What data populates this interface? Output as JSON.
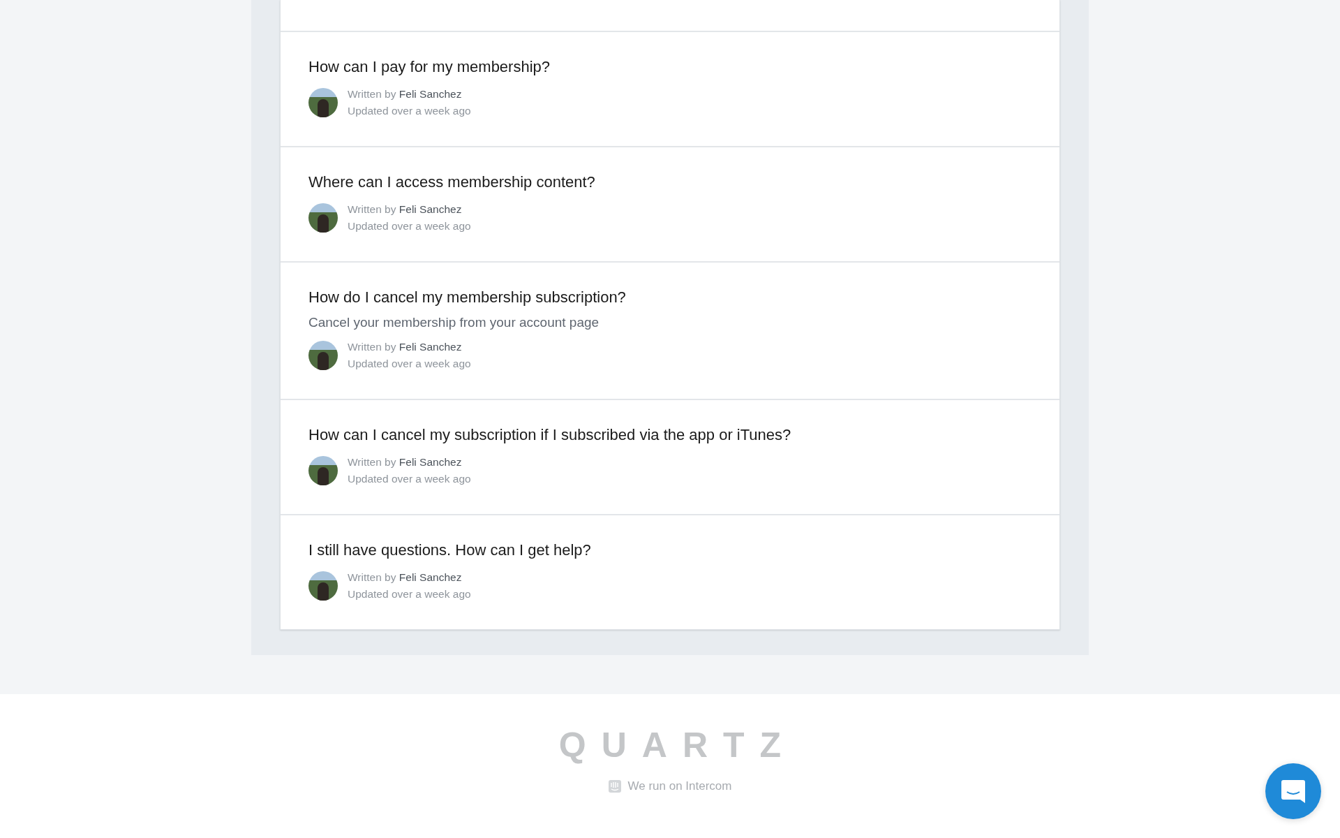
{
  "articles": [
    {
      "title": "How can I pay for my membership?",
      "written_by": "Written by",
      "author": "Feli Sanchez",
      "updated": "Updated over a week ago"
    },
    {
      "title": "Where can I access membership content?",
      "written_by": "Written by",
      "author": "Feli Sanchez",
      "updated": "Updated over a week ago"
    },
    {
      "title": "How do I cancel my membership subscription?",
      "summary": "Cancel your membership from your account page",
      "written_by": "Written by",
      "author": "Feli Sanchez",
      "updated": "Updated over a week ago"
    },
    {
      "title": "How can I cancel my subscription if I subscribed via the app or iTunes?",
      "written_by": "Written by",
      "author": "Feli Sanchez",
      "updated": "Updated over a week ago"
    },
    {
      "title": "I still have questions. How can I get help?",
      "written_by": "Written by",
      "author": "Feli Sanchez",
      "updated": "Updated over a week ago"
    }
  ],
  "footer": {
    "logo": "QUARTZ",
    "powered_by": "We run on Intercom"
  }
}
